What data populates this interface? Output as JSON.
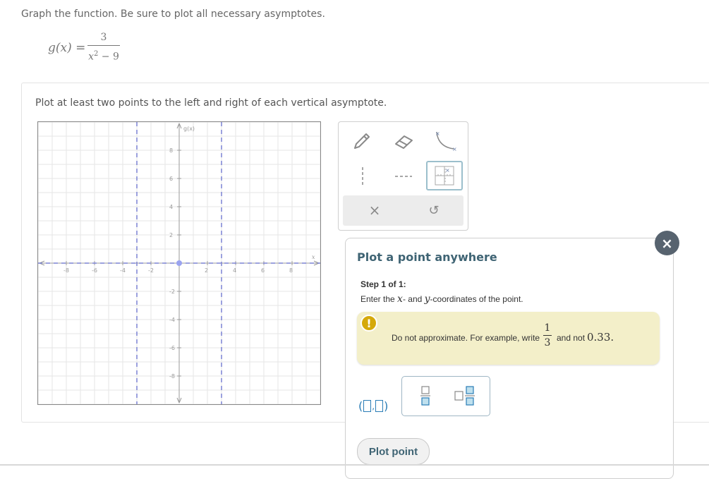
{
  "problem": {
    "prompt": "Graph the function. Be sure to plot all necessary asymptotes.",
    "function_lhs": "g(x) =",
    "numerator": "3",
    "denominator_base": "x",
    "denominator_exp": "2",
    "denominator_rest": " − 9"
  },
  "instruction": "Plot at least two points to the left and right of each vertical asymptote.",
  "graph": {
    "y_axis_label": "g(x)",
    "x_axis_label": "x",
    "x_ticks": [
      "-8",
      "-6",
      "-4",
      "-2",
      "2",
      "4",
      "6",
      "8"
    ],
    "y_ticks": [
      "8",
      "6",
      "4",
      "2",
      "-2",
      "-4",
      "-6",
      "-8"
    ],
    "xlim": [
      -10,
      10
    ],
    "ylim": [
      -10,
      10
    ],
    "vertical_asymptotes": [
      -3,
      3
    ],
    "horizontal_asymptotes": [
      0
    ],
    "points": [
      [
        0,
        0
      ]
    ],
    "colors": {
      "asymptote": "#7b82d4",
      "point": "#9aa3f0",
      "grid": "#e6e6e6",
      "axis": "#999999"
    }
  },
  "toolbox": {
    "tools": [
      "pencil-icon",
      "eraser-icon",
      "curve-icon",
      "vertical-dashed-line-icon",
      "horizontal-dashed-line-icon",
      "point-grid-icon"
    ],
    "selected": "point-grid-icon",
    "clear_symbol": "×",
    "undo_symbol": "↺"
  },
  "modal": {
    "close_symbol": "×",
    "title": "Plot a point anywhere",
    "step": "Step 1 of 1:",
    "step_text_1": "Enter the ",
    "step_var_x": "x",
    "step_text_2": "- and ",
    "step_var_y": "y",
    "step_text_3": "-coordinates of the point.",
    "alert_symbol": "!",
    "alert_text": "Do not approximate. For example, write",
    "alert_frac_num": "1",
    "alert_frac_den": "3",
    "alert_text2": "and not",
    "alert_value": "0.33.",
    "plot_button": "Plot point"
  },
  "colors": {
    "accent": "#2a7db6",
    "title": "#3f6474",
    "alert_bg": "#f3efc9",
    "alert_icon": "#d5a90a",
    "close_bg": "#57636f"
  }
}
